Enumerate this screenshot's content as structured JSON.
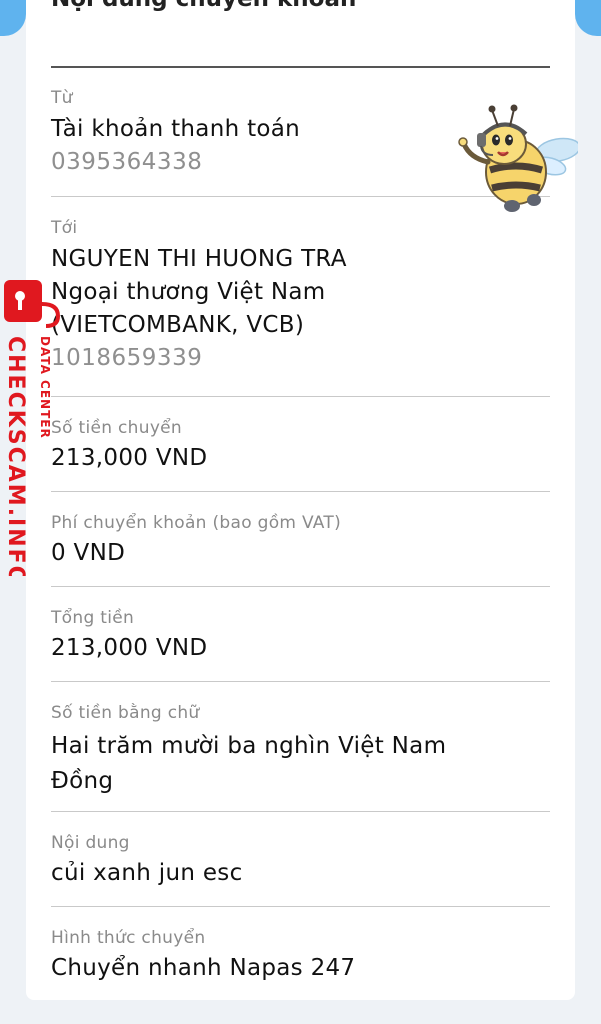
{
  "title": "Nội dung chuyển khoản",
  "from": {
    "label": "Từ",
    "account_type": "Tài khoản thanh toán",
    "account_number": "0395364338"
  },
  "to": {
    "label": "Tới",
    "name": "NGUYEN THI HUONG TRA",
    "bank_line1": "Ngoại thương Việt Nam",
    "bank_line2": "(VIETCOMBANK, VCB)",
    "account_number": "1018659339"
  },
  "amount": {
    "label": "Số tiền chuyển",
    "value": "213,000 VND"
  },
  "fee": {
    "label": "Phí chuyển khoản (bao gồm VAT)",
    "value": "0 VND"
  },
  "total": {
    "label": "Tổng tiền",
    "value": "213,000 VND"
  },
  "amount_words": {
    "label": "Số tiền bằng chữ",
    "line1": "Hai trăm mười ba nghìn Việt Nam",
    "line2": "Đồng"
  },
  "content": {
    "label": "Nội dung",
    "value": "củi xanh jun esc"
  },
  "method": {
    "label": "Hình thức chuyển",
    "value": "Chuyển nhanh Napas 247"
  },
  "watermark": {
    "site": "CHECKSCAM.INFO",
    "tagline": "DATA CENTER",
    "color": "#e0181f"
  },
  "colors": {
    "accent_blue": "#5fb3ee",
    "label_gray": "#8a8a8a",
    "divider": "#c9c9c9"
  }
}
